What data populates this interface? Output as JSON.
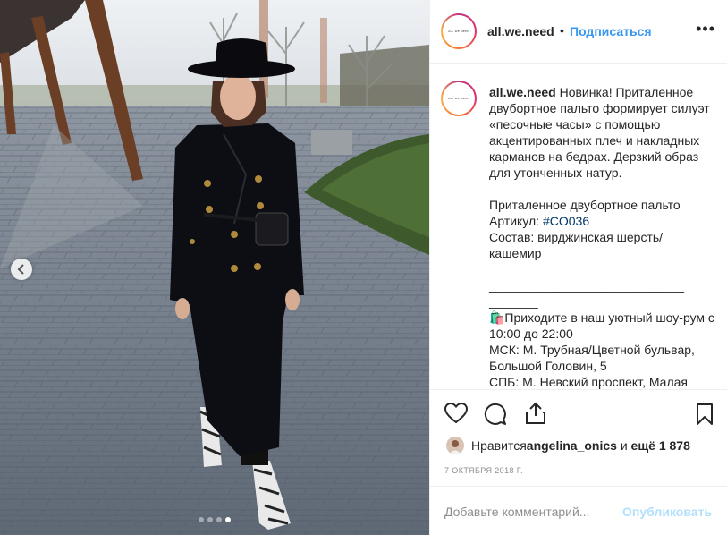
{
  "post": {
    "account": "all.we.need",
    "avatar_logo_text": "ALL WE NEED",
    "separator": "•",
    "follow_label": "Подписаться",
    "more_label": "•••",
    "caption_author": "all.we.need",
    "caption_body_1": " Новинка! Приталенное двубортное пальто формирует силуэт «песочные часы» с помощью акцентированных плеч и накладных карманов на бедрах. Дерзкий образ для утонченных натур.\n\nПриталенное двубортное пальто\nАртикул: ",
    "caption_hashtag": "#CO036",
    "caption_body_2": "\nСостав: вирджинская шерсть/\nкашемир\n\n____________________________\n_______\n🛍️Приходите в наш уютный шоу-рум с 10:00 до 22:00\nМСК: М. Трубная/Цветной бульвар,\nБольшой Головин, 5\nСПБ: М. Невский проспект, Малая",
    "likes_prefix": "Нравится ",
    "liked_by": "angelina_onics",
    "likes_and": " и ",
    "likes_more": "ещё 1 878",
    "date": "7 октября 2018 г.",
    "comment_placeholder": "Добавьте комментарий...",
    "publish_label": "Опубликовать"
  },
  "carousel": {
    "slides": 4,
    "active_index": 3
  },
  "icons": [
    "chevron-left-icon",
    "heart-icon",
    "comment-icon",
    "share-icon",
    "bookmark-icon",
    "more-icon"
  ],
  "colors": {
    "link": "#3897f0",
    "publish_disabled": "#b2dffc",
    "muted": "#8e8e8e",
    "text": "#262626"
  }
}
